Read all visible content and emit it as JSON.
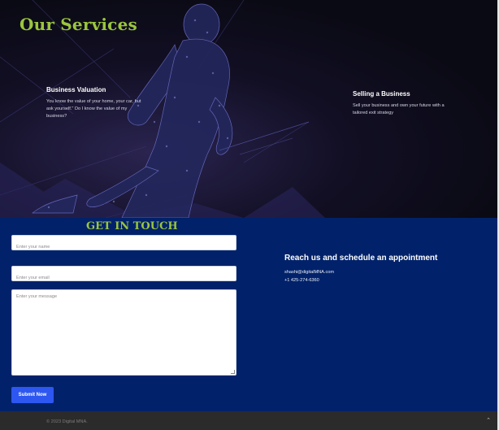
{
  "hero": {
    "title": "Our Services",
    "services": [
      {
        "title": "Business Valuation",
        "description": "You know the value of your home, your car, but ask yourself.\" Do I know the value of my business?"
      },
      {
        "title": "Selling a Business",
        "description": "Sell your business and own your future with a tailored exit strategy"
      }
    ]
  },
  "contact": {
    "title": "GET IN TOUCH",
    "name_placeholder": "Enter your name",
    "email_placeholder": "Enter your email",
    "message_placeholder": "Enter your message",
    "submit_label": "Submit Now",
    "reach_title": "Reach us and schedule an appointment",
    "email": "shashi@digitalMNA.com",
    "phone": "+1 425-274-6360"
  },
  "footer": {
    "copyright": "© 2023 Digital MNA.",
    "to_top_icon": "chevron-up-icon"
  },
  "colors": {
    "accent_green": "#9bc53d",
    "contact_bg": "#01226a",
    "button_blue": "#2d57f0"
  }
}
